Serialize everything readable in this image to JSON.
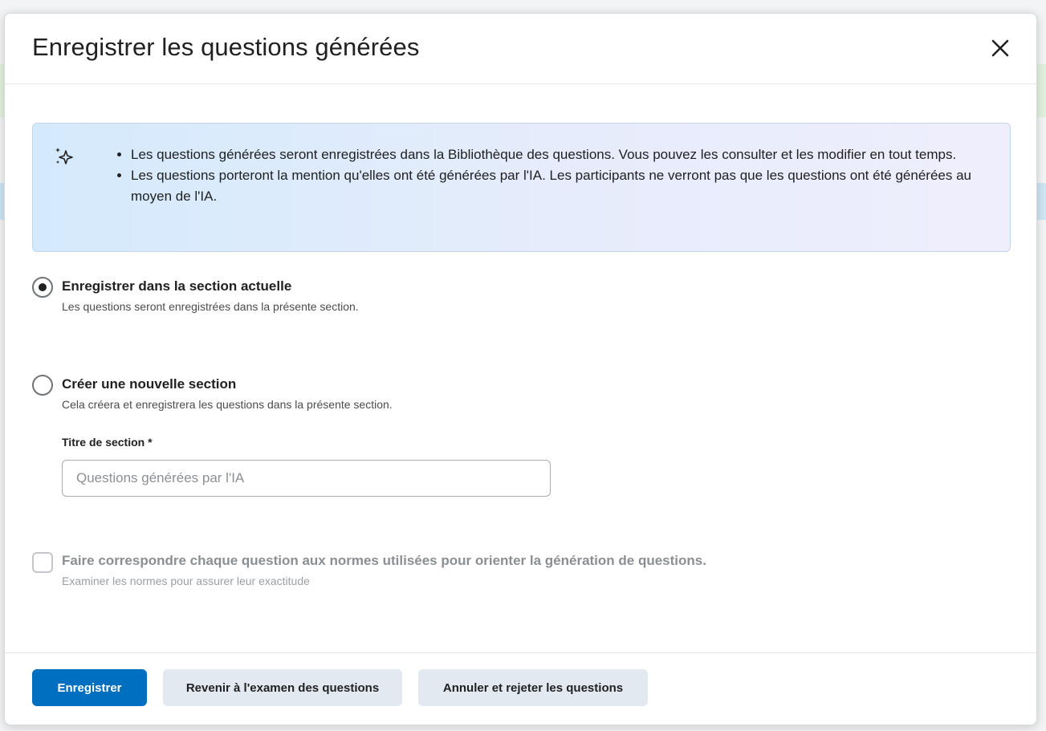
{
  "dialog": {
    "title": "Enregistrer les questions générées",
    "close_icon": "close-icon"
  },
  "info": {
    "icon": "sparkle-icon",
    "bullets": [
      "Les questions générées seront enregistrées dans la Bibliothèque des questions. Vous pouvez les consulter et les modifier en tout temps.",
      "Les questions porteront la mention qu'elles ont été générées par l'IA. Les participants ne verront pas que les questions ont été générées au moyen de l'IA."
    ]
  },
  "options": {
    "current_section": {
      "label": "Enregistrer dans la section actuelle",
      "description": "Les questions seront enregistrées dans la présente section.",
      "checked": true
    },
    "new_section": {
      "label": "Créer une nouvelle section",
      "description": "Cela créera et enregistrera les questions dans la présente section.",
      "checked": false
    }
  },
  "section_title": {
    "label": "Titre de section *",
    "placeholder": "Questions générées par l'IA",
    "value": ""
  },
  "standards": {
    "label": "Faire correspondre chaque question aux normes utilisées pour orienter la génération de questions.",
    "description": "Examiner les normes pour assurer leur exactitude",
    "checked": false
  },
  "footer": {
    "save_label": "Enregistrer",
    "review_label": "Revenir à l'examen des questions",
    "cancel_label": "Annuler et rejeter les questions"
  },
  "colors": {
    "primary": "#006fbf",
    "secondary_button": "#e3e9f1",
    "info_gradient_start": "#d4eafc",
    "info_gradient_end": "#efeefd"
  }
}
